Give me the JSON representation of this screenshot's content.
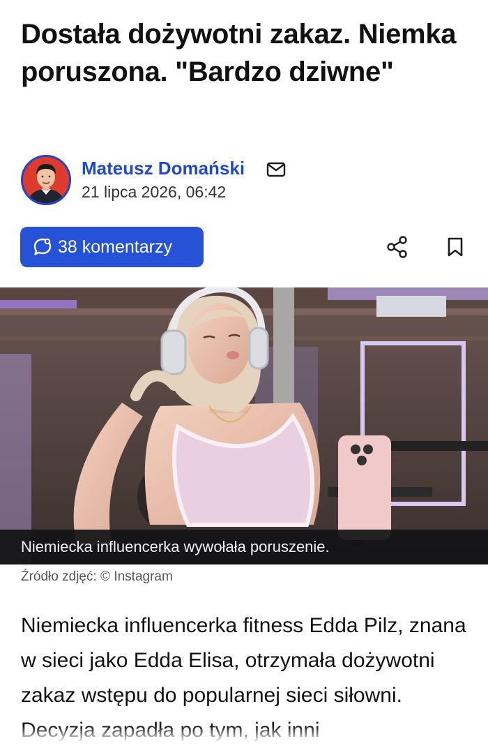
{
  "article": {
    "title": "Dostała dożywotni zakaz. Niemka poruszona. \"Bardzo dziwne\"",
    "author": {
      "name": "Mateusz Domański",
      "date": "21 lipca 2026, 06:42"
    },
    "comments_label": "38 komentarzy",
    "image": {
      "caption": "Niemiecka influencerka wywołała poruszenie.",
      "source": "Źródło zdjęć: © Instagram"
    },
    "lead": "Niemiecka influencerka fitness Edda Pilz, znana w sieci jako Edda Elisa, otrzymała dożywotni zakaz wstępu do popularnej sieci siłowni. Decyzja zapadła po tym, jak inni"
  },
  "icons": {
    "mail": "mail-icon",
    "comments": "chat-bubble-icon",
    "share": "share-icon",
    "bookmark": "bookmark-icon"
  },
  "colors": {
    "accent": "#2552d6",
    "author_link": "#2149c9",
    "caption_bg": "#121216"
  }
}
